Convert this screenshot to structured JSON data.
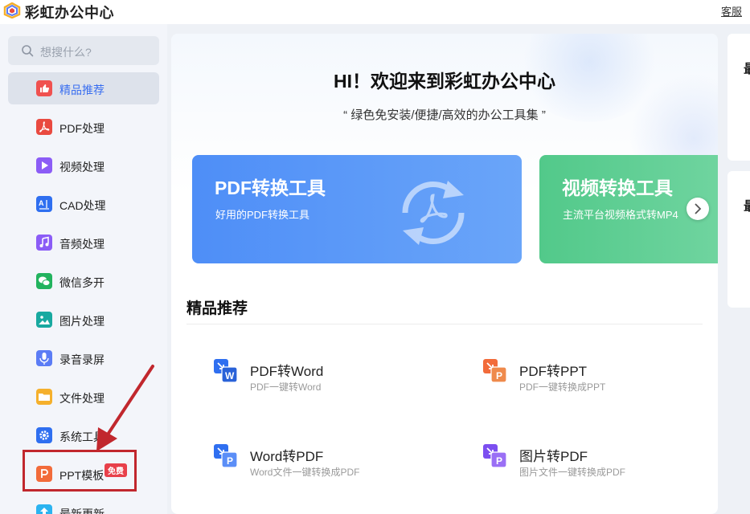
{
  "app": {
    "title": "彩虹办公中心",
    "service_link": "客服"
  },
  "search": {
    "placeholder": "想搜什么?"
  },
  "sidebar": {
    "items": [
      {
        "label": "精品推荐",
        "icon": "thumbs-up-icon",
        "color": "#f0514f",
        "active": true
      },
      {
        "label": "PDF处理",
        "icon": "pdf-icon",
        "color": "#e94a40"
      },
      {
        "label": "视频处理",
        "icon": "video-play-icon",
        "color": "#8b5cf6"
      },
      {
        "label": "CAD处理",
        "icon": "cad-icon",
        "color": "#2f6ff0"
      },
      {
        "label": "音频处理",
        "icon": "music-note-icon",
        "color": "#8b5cf6"
      },
      {
        "label": "微信多开",
        "icon": "wechat-icon",
        "color": "#22b35e"
      },
      {
        "label": "图片处理",
        "icon": "image-icon",
        "color": "#18a9a0"
      },
      {
        "label": "录音录屏",
        "icon": "microphone-icon",
        "color": "#5b7cf5"
      },
      {
        "label": "文件处理",
        "icon": "folder-icon",
        "color": "#f5b02c"
      },
      {
        "label": "系统工具",
        "icon": "gear-icon",
        "color": "#2f6ff0"
      },
      {
        "label": "PPT模板",
        "icon": "ppt-icon",
        "color": "#f26b3a",
        "badge": "免费"
      },
      {
        "label": "最新更新",
        "icon": "update-arrow-icon",
        "color": "#2bb3f0"
      }
    ]
  },
  "main": {
    "welcome": "HI！欢迎来到彩虹办公中心",
    "tagline": "“ 绿色免安装/便捷/高效的办公工具集 ”",
    "banners": [
      {
        "title": "PDF转换工具",
        "subtitle": "好用的PDF转换工具",
        "color": "#4e8ef7"
      },
      {
        "title": "视频转换工具",
        "subtitle": "主流平台视频格式转MP4",
        "color": "#52c98a"
      }
    ],
    "section_title": "精品推荐",
    "tools": [
      {
        "name": "PDF转Word",
        "desc": "PDF一键转Word",
        "icon": "pdf-to-word-icon",
        "letter": "W"
      },
      {
        "name": "PDF转PPT",
        "desc": "PDF一键转换成PPT",
        "icon": "pdf-to-ppt-icon",
        "letter": "P"
      },
      {
        "name": "Word转PDF",
        "desc": "Word文件一键转换成PDF",
        "icon": "word-to-pdf-icon",
        "letter": "P"
      },
      {
        "name": "图片转PDF",
        "desc": "图片文件一键转换成PDF",
        "icon": "image-to-pdf-icon",
        "letter": "P"
      }
    ]
  },
  "right_panel": {
    "card1_text": "最",
    "card2_text": "最"
  },
  "colors": {
    "accent": "#3a6ff0",
    "annotation_red": "#c1272d"
  }
}
